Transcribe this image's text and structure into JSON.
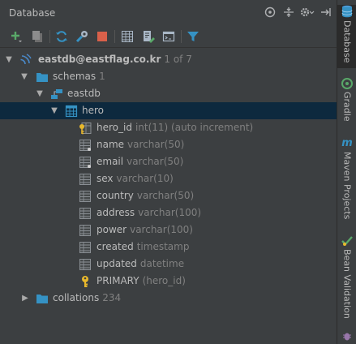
{
  "header": {
    "title": "Database"
  },
  "tree": {
    "connection": {
      "label": "eastdb@eastflag.co.kr",
      "meta": "1 of 7"
    },
    "schemas": {
      "label": "schemas",
      "meta": "1"
    },
    "schema": {
      "label": "eastdb"
    },
    "table": {
      "label": "hero"
    },
    "columns": [
      {
        "name": "hero_id",
        "type": "int(11) (auto increment)"
      },
      {
        "name": "name",
        "type": "varchar(50)"
      },
      {
        "name": "email",
        "type": "varchar(50)"
      },
      {
        "name": "sex",
        "type": "varchar(10)"
      },
      {
        "name": "country",
        "type": "varchar(50)"
      },
      {
        "name": "address",
        "type": "varchar(100)"
      },
      {
        "name": "power",
        "type": "varchar(100)"
      },
      {
        "name": "created",
        "type": "timestamp"
      },
      {
        "name": "updated",
        "type": "datetime"
      }
    ],
    "key": {
      "name": "PRIMARY",
      "type": "(hero_id)"
    },
    "collations": {
      "label": "collations",
      "meta": "234"
    }
  },
  "sidebar": {
    "tabs": [
      {
        "label": "Database"
      },
      {
        "label": "Gradle"
      },
      {
        "label": "Maven Projects"
      },
      {
        "label": "Bean Validation"
      }
    ]
  },
  "colors": {
    "panel_bg": "#3c3f41",
    "selection": "#0d293e",
    "text": "#bbbbbb",
    "dim_text": "#808080",
    "accent_blue": "#3592c4"
  }
}
